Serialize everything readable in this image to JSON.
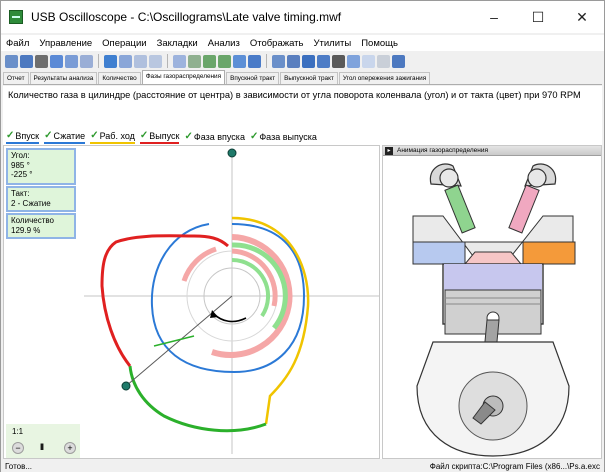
{
  "window": {
    "title": "USB Oscilloscope - C:\\Oscillograms\\Late valve timing.mwf",
    "minimize": "–",
    "maximize": "☐",
    "close": "✕"
  },
  "menu": [
    "Файл",
    "Управление",
    "Операции",
    "Закладки",
    "Анализ",
    "Отображать",
    "Утилиты",
    "Помощь"
  ],
  "tabs": [
    {
      "label": "Отчет",
      "active": false
    },
    {
      "label": "Результаты анализа",
      "active": false
    },
    {
      "label": "Количество",
      "active": false
    },
    {
      "label": "Фазы газораспределения",
      "active": true
    },
    {
      "label": "Впускной тракт",
      "active": false
    },
    {
      "label": "Выпускной тракт",
      "active": false
    },
    {
      "label": "Угол опережения зажигания",
      "active": false
    }
  ],
  "description": "Количество газа в цилиндре (расстояние от центра) в зависимости от угла поворота коленвала (угол) и от такта (цвет) при 970 RPM",
  "legend": [
    {
      "label": "Впуск",
      "color": "#2b79d6"
    },
    {
      "label": "Сжатие",
      "color": "#2b79d6"
    },
    {
      "label": "Раб. ход",
      "color": "#f0c400"
    },
    {
      "label": "Выпуск",
      "color": "#e02020"
    },
    {
      "label": "Фаза впуска",
      "color": "#3fbf3f"
    },
    {
      "label": "Фаза выпуска",
      "color": "#3fbf3f"
    }
  ],
  "info": {
    "angle_label": "Угол:",
    "angle_value1": "985 °",
    "angle_value2": "-225 °",
    "stroke_label": "Такт:",
    "stroke_value": "2 - Сжатие",
    "qty_label": "Количество",
    "qty_value": "129.9 %"
  },
  "controls": {
    "scale": "1:1",
    "zoom_out": "−",
    "pause": "II",
    "zoom_in": "+"
  },
  "animation": {
    "title": "Анимация газораспределения"
  },
  "status": {
    "left": "Готов...",
    "right": "Файл скрипта:C:\\Program Files (x86...\\Ps.a.exc"
  },
  "colors": {
    "intake": "#2b79d6",
    "compression": "#2b79d6",
    "power": "#f0c400",
    "exhaust": "#e02020",
    "phase": "#3fbf3f",
    "valve_phase_pink": "#f5a7a7"
  }
}
